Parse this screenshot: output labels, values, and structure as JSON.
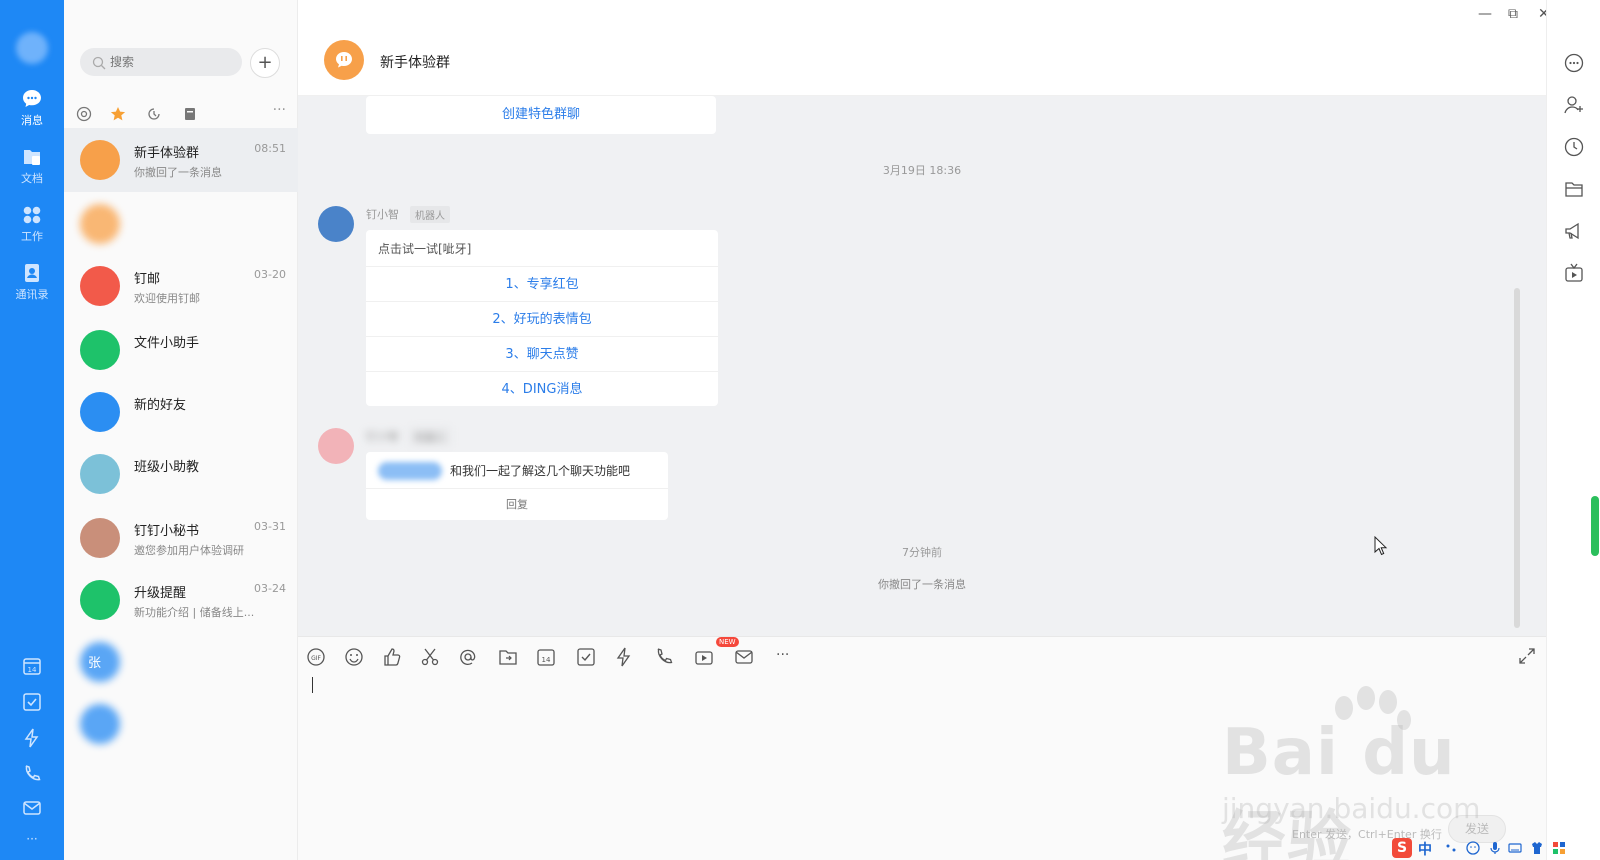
{
  "nav": {
    "items": [
      {
        "label": "消息",
        "icon": "chat-bubble-icon"
      },
      {
        "label": "文档",
        "icon": "document-folder-icon"
      },
      {
        "label": "工作",
        "icon": "apps-grid-icon"
      },
      {
        "label": "通讯录",
        "icon": "contacts-icon"
      }
    ],
    "more": "···"
  },
  "list": {
    "search_placeholder": "搜索",
    "add": "+",
    "filter_more": "···",
    "conversations": [
      {
        "name": "新手体验群",
        "time": "08:51",
        "preview": "你撤回了一条消息",
        "color": "#f7a04a"
      },
      {
        "name": "",
        "time": "",
        "preview": "",
        "color": "#f9b774"
      },
      {
        "name": "钉邮",
        "time": "03-20",
        "preview": "欢迎使用钉邮",
        "color": "#f25a4a"
      },
      {
        "name": "文件小助手",
        "time": "",
        "preview": "",
        "color": "#1ec26a"
      },
      {
        "name": "新的好友",
        "time": "",
        "preview": "",
        "color": "#2b8ef2"
      },
      {
        "name": "班级小助教",
        "time": "",
        "preview": "",
        "color": "#7cc1d8"
      },
      {
        "name": "钉钉小秘书",
        "time": "03-31",
        "preview": "邀您参加用户体验调研",
        "color": "#c98f7a"
      },
      {
        "name": "升级提醒",
        "time": "03-24",
        "preview": "新功能介绍 | 储备线上...",
        "color": "#1ec26a"
      },
      {
        "name": "张",
        "time": "",
        "preview": "",
        "color": "#5aa6f5"
      },
      {
        "name": "",
        "time": "",
        "preview": "",
        "color": "#5aa6f5"
      }
    ]
  },
  "chat": {
    "title": "新手体验群",
    "create_group_btn": "创建特色群聊",
    "timestamp1": "3月19日 18:36",
    "bot_name": "钉小智",
    "bot_tag": "机器人",
    "menu_intro": "点击试一试[呲牙]",
    "menu_options": [
      "1、专享红包",
      "2、好玩的表情包",
      "3、聊天点赞",
      "4、DING消息"
    ],
    "intro_text": "和我们一起了解这几个聊天功能吧",
    "reply": "回复",
    "timestamp2": "7分钟前",
    "recall_notice": "你撤回了一条消息"
  },
  "composer": {
    "new_badge": "NEW",
    "hint": "Enter 发送，Ctrl+Enter 换行",
    "send": "发送",
    "more": "···"
  },
  "window": {
    "minimize": "—",
    "restore": "⧉",
    "close": "✕"
  },
  "watermark": {
    "logo": "Bai du 经验",
    "url": "jingyan.baidu.com"
  },
  "tray": {
    "ime_logo": "S",
    "ime_lang": "中"
  }
}
